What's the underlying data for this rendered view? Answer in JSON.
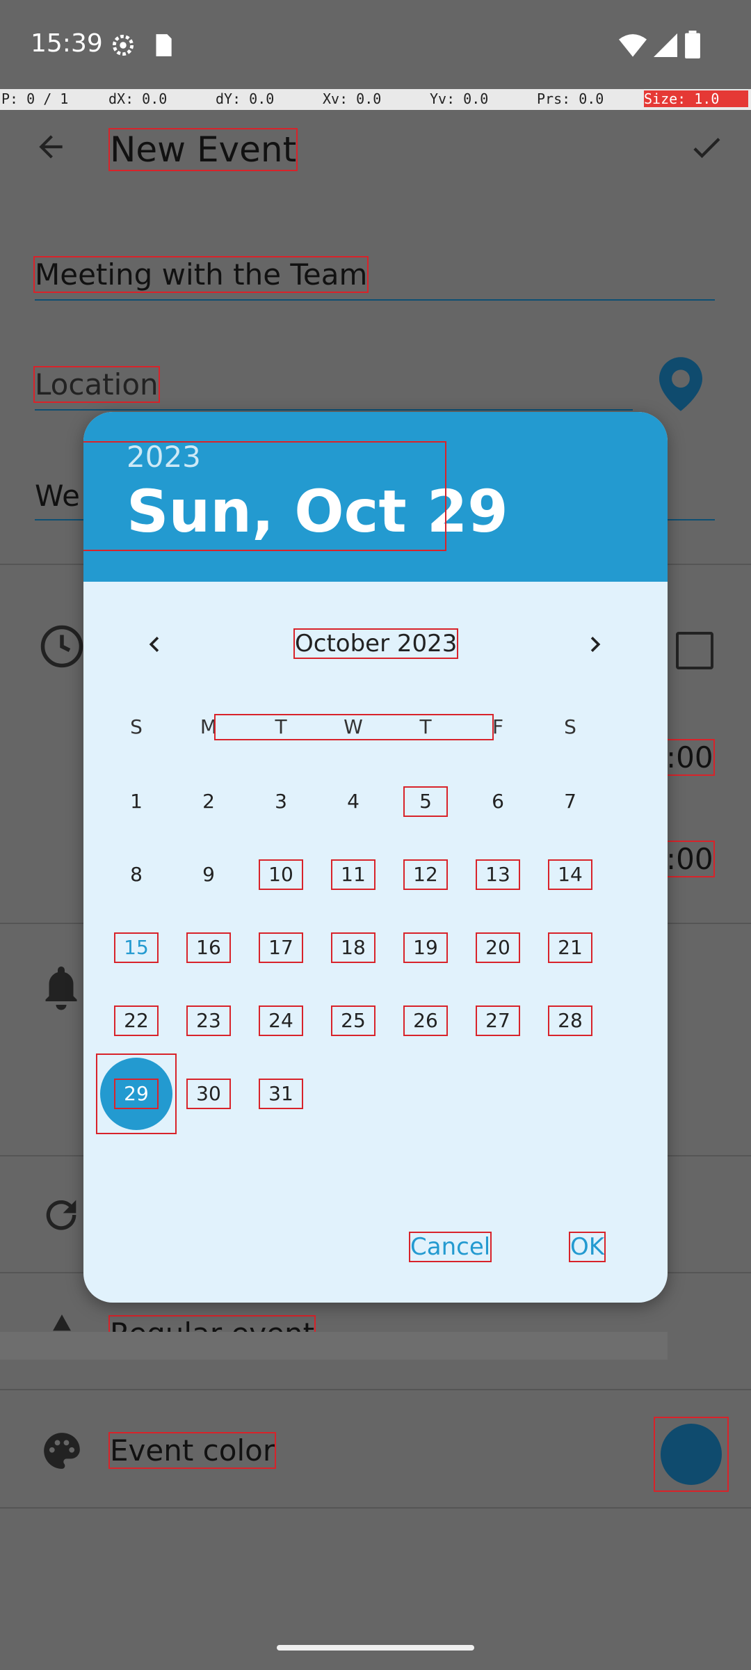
{
  "status_bar": {
    "time": "15:39",
    "icons": [
      "settings-gear-icon",
      "sd-card-icon",
      "wifi-icon",
      "signal-icon",
      "battery-icon"
    ]
  },
  "debug_bar": {
    "p": "P: 0 / 1",
    "dx": "dX: 0.0",
    "dy": "dY: 0.0",
    "xv": "Xv: 0.0",
    "yv": "Yv: 0.0",
    "prs": "Prs: 0.0",
    "size": "Size: 1.0"
  },
  "app_bar": {
    "title": "New Event",
    "back_icon": "arrow-back-icon",
    "confirm_icon": "checkmark-icon"
  },
  "form": {
    "title_value": "Meeting with the Team",
    "location_placeholder": "Location",
    "location_icon": "map-pin-icon",
    "description_partial": "We",
    "time_end_1": ":00",
    "time_end_2": ":00",
    "event_type": "Regular event",
    "event_color_label": "Event color",
    "event_color_swatch": "#0f4b6e"
  },
  "date_picker": {
    "year": "2023",
    "selected_date": "Sun, Oct 29",
    "month_label": "October 2023",
    "weekdays": [
      "S",
      "M",
      "T",
      "W",
      "T",
      "F",
      "S"
    ],
    "days": [
      "1",
      "2",
      "3",
      "4",
      "5",
      "6",
      "7",
      "8",
      "9",
      "10",
      "11",
      "12",
      "13",
      "14",
      "15",
      "16",
      "17",
      "18",
      "19",
      "20",
      "21",
      "22",
      "23",
      "24",
      "25",
      "26",
      "27",
      "28",
      "29",
      "30",
      "31"
    ],
    "today_day": "15",
    "selected_day": "29",
    "cancel_label": "Cancel",
    "ok_label": "OK",
    "accent_color": "#239ad0"
  }
}
